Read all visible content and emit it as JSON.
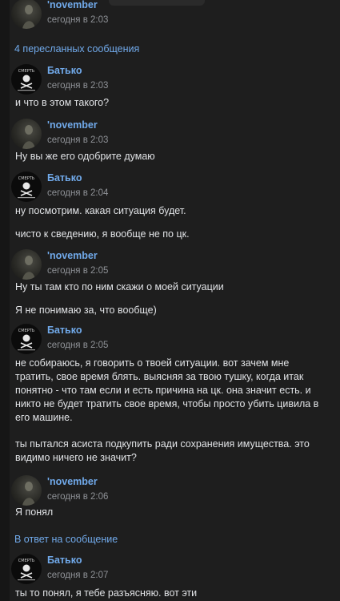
{
  "forwarded_header": "4 пересланных сообщения",
  "reply_header": "В ответ на сообщение",
  "top_message": {
    "author": "'november",
    "time": "сегодня в 2:03"
  },
  "messages": [
    {
      "author": "Батько",
      "time": "сегодня в 2:03",
      "lines": [
        "и что в этом такого?"
      ]
    },
    {
      "author": "'november",
      "time": "сегодня в 2:03",
      "lines": [
        "Ну вы же его одобрите думаю"
      ]
    },
    {
      "author": "Батько",
      "time": "сегодня в 2:04",
      "lines": [
        "ну посмотрим. какая ситуация будет.",
        "чисто к сведению, я вообще не по цк."
      ]
    },
    {
      "author": "'november",
      "time": "сегодня в 2:05",
      "lines": [
        "Ну ты там кто по ним скажи о моей ситуации",
        "Я не понимаю за, что вообще)"
      ]
    },
    {
      "author": "Батько",
      "time": "сегодня в 2:05",
      "lines": [
        "не собираюсь, я говорить о твоей ситуации. вот зачем мне тратить, свое время блять. выясняя за твою тушку, когда итак понятно - что там если и есть причина на цк. она значит есть. и никто не будет тратить свое время, чтобы просто убить цивила в его машине.",
        "ты пытался асиста подкупить ради сохранения имущества. это видимо ничего не значит?"
      ]
    },
    {
      "author": "'november",
      "time": "сегодня в 2:06",
      "lines": [
        "Я понял"
      ]
    },
    {
      "author": "Батько",
      "time": "сегодня в 2:07",
      "lines": [
        "ты то понял, я тебе разъясняю. вот эти"
      ]
    }
  ],
  "avatar_texts": {
    "batko_caption": "СМЕРТЬ"
  },
  "colors": {
    "background": "#1e1e1e",
    "link": "#71aaeb",
    "text": "#e1e3e6",
    "muted": "#8f9297"
  }
}
